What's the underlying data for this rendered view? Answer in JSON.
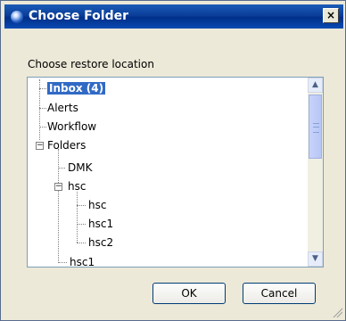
{
  "window": {
    "title": "Choose Folder",
    "close_glyph": "×"
  },
  "dialog": {
    "prompt": "Choose restore location"
  },
  "tree": {
    "items": [
      {
        "label": "Inbox (4)",
        "selected": true
      },
      {
        "label": "Alerts"
      },
      {
        "label": "Workflow"
      },
      {
        "label": "Folders",
        "toggle": "−"
      },
      {
        "label": "DMK"
      },
      {
        "label": "hsc",
        "toggle": "−"
      },
      {
        "label": "hsc"
      },
      {
        "label": "hsc1"
      },
      {
        "label": "hsc2"
      },
      {
        "label": "hsc1"
      }
    ]
  },
  "scrollbar": {
    "up_glyph": "▲",
    "down_glyph": "▼"
  },
  "buttons": {
    "ok": "OK",
    "cancel": "Cancel"
  },
  "colors": {
    "selection": "#316ac5",
    "titlebar": "#0a3e99"
  }
}
